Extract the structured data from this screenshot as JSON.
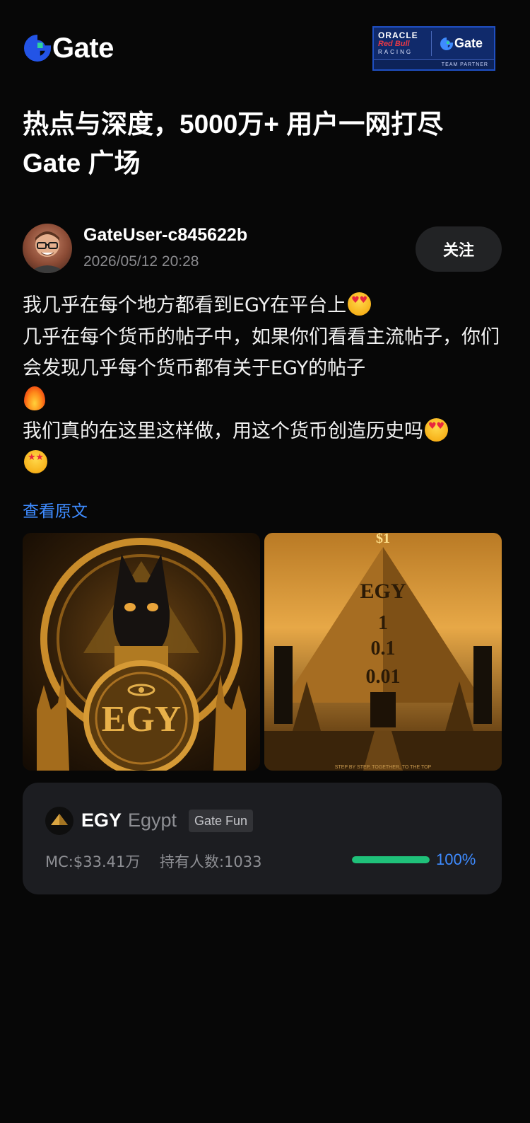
{
  "header": {
    "brand": "Gate",
    "partner": {
      "line1": "ORACLE",
      "line2": "Red Bull",
      "line3": "RACING",
      "brand": "Gate",
      "caption": "TEAM PARTNER"
    }
  },
  "headline": {
    "line1": "热点与深度，5000万+ 用户一网打尽",
    "line2": "Gate 广场"
  },
  "post": {
    "username": "GateUser-c845622b",
    "datetime": "2026/05/12 20:28",
    "follow_label": "关注",
    "text": {
      "p1": "我几乎在每个地方都看到EGY在平台上",
      "p2": "几乎在每个货币的帖子中，如果你们看看主流帖子，你们会发现几乎每个货币都有关于EGY的帖子",
      "p3": "我们真的在这里这样做，用这个货币创造历史吗"
    },
    "emoji": {
      "heart_eyes": "smiling-face-with-heart-eyes-icon",
      "fire": "fire-icon",
      "star_struck": "star-struck-icon"
    },
    "view_original": "查看原文",
    "images": {
      "left_text": "EGY",
      "right_lines": [
        "$1",
        "EGY",
        "1",
        "0.1",
        "0.01"
      ],
      "right_caption": "STEP BY STEP, TOGETHER, TO THE TOP"
    }
  },
  "coin": {
    "symbol": "EGY",
    "name": "Egypt",
    "tag": "Gate Fun",
    "mc": "MC:$33.41万",
    "holders": "持有人数:1033",
    "progress": 1.0,
    "progress_label": "100%"
  },
  "colors": {
    "background": "#070707",
    "accent_blue": "#3e8bff",
    "progress_green": "#1fc17a",
    "card": "#1c1d21"
  }
}
